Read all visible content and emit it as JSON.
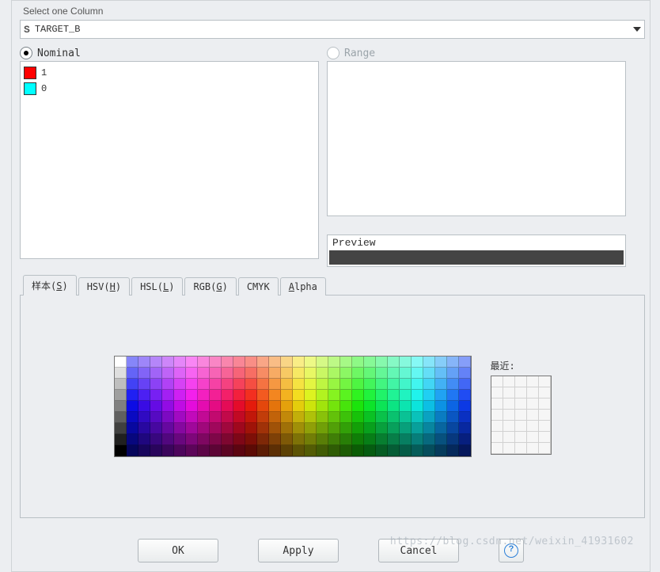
{
  "sectionLabel": "Select one Column",
  "comboValue": "TARGET_B",
  "radios": {
    "nominal": "Nominal",
    "range": "Range"
  },
  "items": [
    {
      "label": "1",
      "color": "#ff0000"
    },
    {
      "label": "0",
      "color": "#00ffff"
    }
  ],
  "previewLabel": "Preview",
  "previewColor": "#444444",
  "tabs": [
    "样本(S)",
    "HSV(H)",
    "HSL(L)",
    "RGB(G)",
    "CMYK",
    "Alpha"
  ],
  "activeTab": 0,
  "recentLabel": "最近:",
  "buttons": {
    "ok": "OK",
    "apply": "Apply",
    "cancel": "Cancel"
  },
  "watermark": "https://blog.csdn.net/weixin_41931602"
}
